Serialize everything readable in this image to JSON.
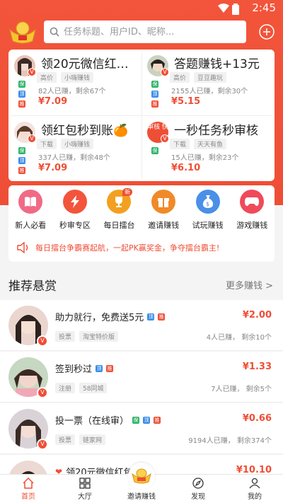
{
  "status": {
    "time": "2:45"
  },
  "colors": {
    "brand": "#ef4e36",
    "green": "#2fb36a",
    "blue": "#3a8de8"
  },
  "header": {
    "search_placeholder": "任务标题、用户ID、昵称..."
  },
  "task_cards": [
    {
      "title": "领20元微信红包...",
      "tags": [
        "高价",
        "小嗨赚钱"
      ],
      "stats": "82人已赚，剩余67个",
      "price": "¥7.09"
    },
    {
      "title": "答题赚钱+13元",
      "tags": [
        "高价",
        "豆豆趣玩"
      ],
      "stats": "2155人已赚，剩余30个",
      "price": "¥5.15"
    },
    {
      "title": "领红包秒到账🍊",
      "tags": [
        "下载",
        "小嗨赚钱"
      ],
      "stats": "337人已赚，剩余48个",
      "price": "¥7.09"
    },
    {
      "title": "一秒任务秒审核",
      "tags": [
        "下载",
        "天天有鱼"
      ],
      "stats": "15人已赚，剩余23个",
      "price": "¥6.10",
      "avatar_text": "审核 快"
    }
  ],
  "mini_badges": {
    "g": "保",
    "b": "顶",
    "r": "推"
  },
  "menu": {
    "items": [
      {
        "label": "新人必看",
        "icon": "book-icon",
        "color": "#f06a86"
      },
      {
        "label": "秒审专区",
        "icon": "lightning-icon",
        "color": "#f2553b"
      },
      {
        "label": "每日擂台",
        "icon": "trophy-icon",
        "color": "#f3a020",
        "badge": "新"
      },
      {
        "label": "邀请赚钱",
        "icon": "gift-icon",
        "color": "#f08a28"
      },
      {
        "label": "试玩赚钱",
        "icon": "money-bag-icon",
        "color": "#4a8fe8"
      },
      {
        "label": "游戏赚钱",
        "icon": "gamepad-icon",
        "color": "#f04a5a"
      }
    ],
    "notice": "每日擂台争霸赛起航，一起PK赢奖金，争夺擂台霸主!"
  },
  "recommend": {
    "title": "推荐悬赏",
    "more": "更多赚钱 >",
    "rows": [
      {
        "title": "助力就行，免费送5元",
        "badges": [
          "b",
          "r"
        ],
        "tags": [
          "投票",
          "淘宝特价版"
        ],
        "price": "¥2.00",
        "stats": "4人已赚，  剩余10个"
      },
      {
        "title": "签到秒过",
        "badges": [
          "b",
          "r"
        ],
        "tags": [
          "注册",
          "58同城"
        ],
        "price": "¥1.33",
        "stats": "7人已赚，  剩余5个"
      },
      {
        "title": "投一票（在线审）",
        "badges": [
          "g",
          "b",
          "r"
        ],
        "tags": [
          "投票",
          "链家网"
        ],
        "price": "¥0.66",
        "stats": "9194人已赚，  剩余374个"
      },
      {
        "title": "领20元微信红包",
        "heart": "❤",
        "badges": [],
        "tags": [],
        "price": "¥10.10",
        "stats": ""
      }
    ]
  },
  "bottom_nav": [
    {
      "label": "首页",
      "icon": "home-icon",
      "active": true
    },
    {
      "label": "大厅",
      "icon": "grid-icon",
      "active": false
    },
    {
      "label": "邀请赚钱",
      "icon": "ingot-icon",
      "active": false
    },
    {
      "label": "发现",
      "icon": "compass-icon",
      "active": false
    },
    {
      "label": "我的",
      "icon": "person-icon",
      "active": false
    }
  ]
}
